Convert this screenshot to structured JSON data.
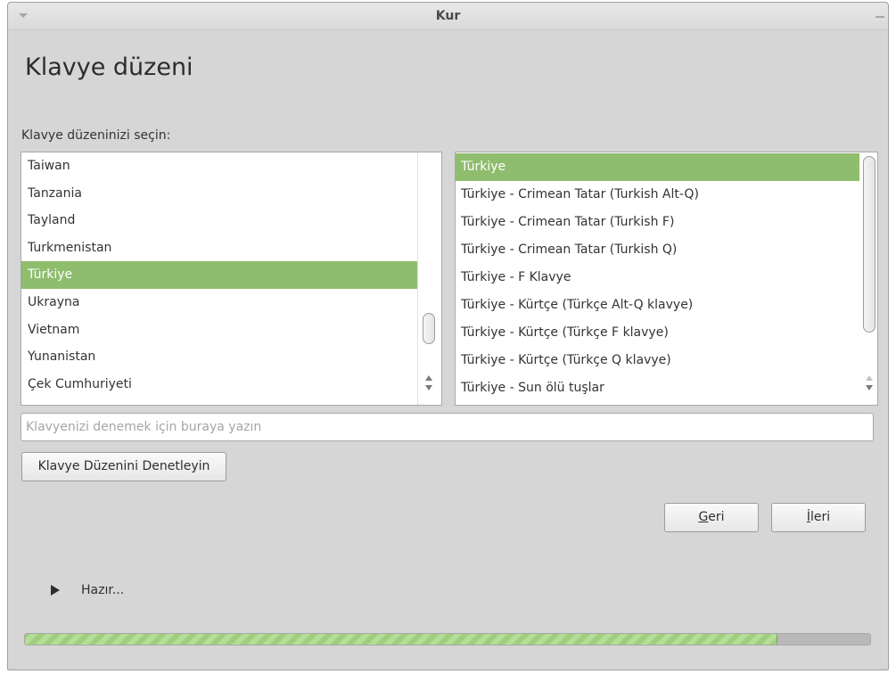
{
  "window": {
    "title": "Kur"
  },
  "page": {
    "heading": "Klavye düzeni",
    "prompt": "Klavye düzeninizi seçin:"
  },
  "layouts": {
    "items": [
      "Taiwan",
      "Tanzania",
      "Tayland",
      "Turkmenistan",
      "Türkiye",
      "Ukrayna",
      "Vietnam",
      "Yunanistan",
      "Çek Cumhuriyeti"
    ],
    "selected": "Türkiye"
  },
  "variants": {
    "items": [
      "Türkiye",
      "Türkiye - Crimean Tatar (Turkish Alt-Q)",
      "Türkiye - Crimean Tatar (Turkish F)",
      "Türkiye - Crimean Tatar (Turkish Q)",
      "Türkiye - F Klavye",
      "Türkiye - Kürtçe (Türkçe Alt-Q klavye)",
      "Türkiye - Kürtçe (Türkçe F klavye)",
      "Türkiye - Kürtçe (Türkçe Q klavye)",
      "Türkiye - Sun ölü tuşlar"
    ],
    "selected": "Türkiye"
  },
  "test_field": {
    "value": "",
    "placeholder": "Klavyenizi denemek için buraya yazın"
  },
  "buttons": {
    "check": "Klavye Düzenini Denetleyin",
    "back_mnemonic": "G",
    "back_rest": "eri",
    "next_mnemonic": "İ",
    "next_rest": "leri"
  },
  "status": {
    "text": "Hazır...",
    "progress": 0.89
  },
  "colors": {
    "selection": "#8fbd6e",
    "progress": "#9fcf7d"
  }
}
